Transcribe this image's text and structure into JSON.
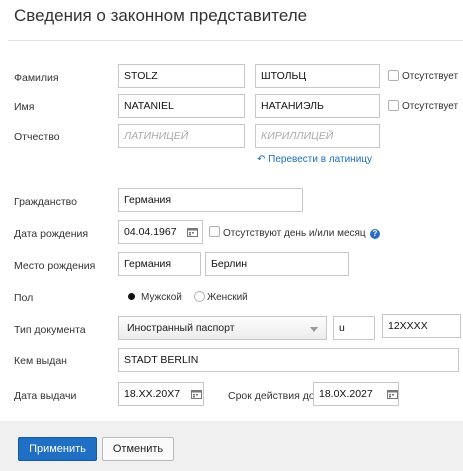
{
  "header": {
    "title": "Сведения о законном представителе"
  },
  "fields": {
    "surname": {
      "label": "Фамилия",
      "latin": "STOLZ",
      "cyrillic": "ШТОЛЬЦ",
      "absent_label": "Отсутствует"
    },
    "name": {
      "label": "Имя",
      "latin": "NATANIEL",
      "cyrillic": "НАТАНИЭЛЬ",
      "absent_label": "Отсутствует"
    },
    "patronymic": {
      "label": "Отчество",
      "latin_placeholder": "ЛАТИНИЦЕЙ",
      "cyrillic_placeholder": "КИРИЛЛИЦЕЙ"
    },
    "translate_link": "Перевести в латиницу",
    "citizenship": {
      "label": "Гражданство",
      "value": "Германия"
    },
    "birth_date": {
      "label": "Дата рождения",
      "value": "04.04.1967",
      "absent_label": "Отсутствуют день и/или месяц",
      "help": "?"
    },
    "birth_place": {
      "label": "Место рождения",
      "country": "Германия",
      "city": "Берлин"
    },
    "gender": {
      "label": "Пол",
      "male": "Мужской",
      "female": "Женский",
      "selected": "male"
    },
    "doc_type": {
      "label": "Тип документа",
      "value": "Иностранный паспорт",
      "series": "u",
      "number": "12XXXX"
    },
    "issued_by": {
      "label": "Кем выдан",
      "value": "STADT BERLIN"
    },
    "issue_date": {
      "label": "Дата выдачи",
      "value": "18.XX.20X7"
    },
    "expiry": {
      "label": "Срок действия до",
      "value": "18.0X.2027"
    }
  },
  "buttons": {
    "apply": "Применить",
    "cancel": "Отменить"
  },
  "colors": {
    "primary": "#1f6fc5",
    "link": "#1d6fb8",
    "footer_bg": "#f0f0f0"
  }
}
